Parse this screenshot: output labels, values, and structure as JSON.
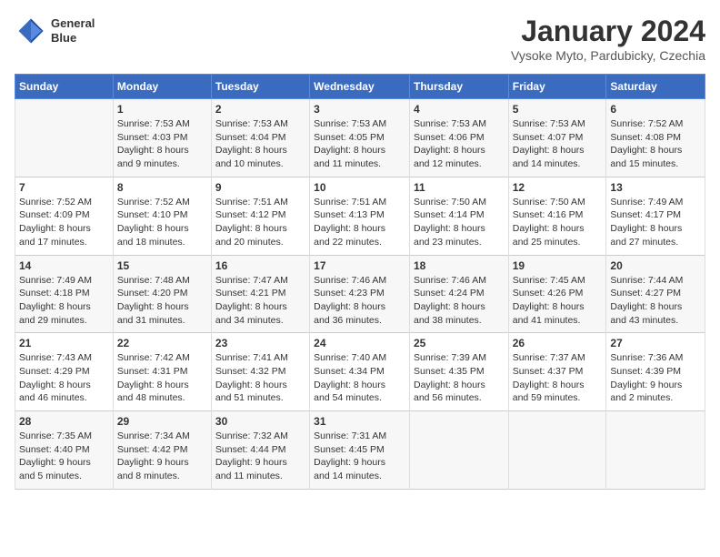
{
  "logo": {
    "line1": "General",
    "line2": "Blue"
  },
  "title": "January 2024",
  "subtitle": "Vysoke Myto, Pardubicky, Czechia",
  "days_header": [
    "Sunday",
    "Monday",
    "Tuesday",
    "Wednesday",
    "Thursday",
    "Friday",
    "Saturday"
  ],
  "weeks": [
    [
      {
        "day": "",
        "info": ""
      },
      {
        "day": "1",
        "info": "Sunrise: 7:53 AM\nSunset: 4:03 PM\nDaylight: 8 hours\nand 9 minutes."
      },
      {
        "day": "2",
        "info": "Sunrise: 7:53 AM\nSunset: 4:04 PM\nDaylight: 8 hours\nand 10 minutes."
      },
      {
        "day": "3",
        "info": "Sunrise: 7:53 AM\nSunset: 4:05 PM\nDaylight: 8 hours\nand 11 minutes."
      },
      {
        "day": "4",
        "info": "Sunrise: 7:53 AM\nSunset: 4:06 PM\nDaylight: 8 hours\nand 12 minutes."
      },
      {
        "day": "5",
        "info": "Sunrise: 7:53 AM\nSunset: 4:07 PM\nDaylight: 8 hours\nand 14 minutes."
      },
      {
        "day": "6",
        "info": "Sunrise: 7:52 AM\nSunset: 4:08 PM\nDaylight: 8 hours\nand 15 minutes."
      }
    ],
    [
      {
        "day": "7",
        "info": "Sunrise: 7:52 AM\nSunset: 4:09 PM\nDaylight: 8 hours\nand 17 minutes."
      },
      {
        "day": "8",
        "info": "Sunrise: 7:52 AM\nSunset: 4:10 PM\nDaylight: 8 hours\nand 18 minutes."
      },
      {
        "day": "9",
        "info": "Sunrise: 7:51 AM\nSunset: 4:12 PM\nDaylight: 8 hours\nand 20 minutes."
      },
      {
        "day": "10",
        "info": "Sunrise: 7:51 AM\nSunset: 4:13 PM\nDaylight: 8 hours\nand 22 minutes."
      },
      {
        "day": "11",
        "info": "Sunrise: 7:50 AM\nSunset: 4:14 PM\nDaylight: 8 hours\nand 23 minutes."
      },
      {
        "day": "12",
        "info": "Sunrise: 7:50 AM\nSunset: 4:16 PM\nDaylight: 8 hours\nand 25 minutes."
      },
      {
        "day": "13",
        "info": "Sunrise: 7:49 AM\nSunset: 4:17 PM\nDaylight: 8 hours\nand 27 minutes."
      }
    ],
    [
      {
        "day": "14",
        "info": "Sunrise: 7:49 AM\nSunset: 4:18 PM\nDaylight: 8 hours\nand 29 minutes."
      },
      {
        "day": "15",
        "info": "Sunrise: 7:48 AM\nSunset: 4:20 PM\nDaylight: 8 hours\nand 31 minutes."
      },
      {
        "day": "16",
        "info": "Sunrise: 7:47 AM\nSunset: 4:21 PM\nDaylight: 8 hours\nand 34 minutes."
      },
      {
        "day": "17",
        "info": "Sunrise: 7:46 AM\nSunset: 4:23 PM\nDaylight: 8 hours\nand 36 minutes."
      },
      {
        "day": "18",
        "info": "Sunrise: 7:46 AM\nSunset: 4:24 PM\nDaylight: 8 hours\nand 38 minutes."
      },
      {
        "day": "19",
        "info": "Sunrise: 7:45 AM\nSunset: 4:26 PM\nDaylight: 8 hours\nand 41 minutes."
      },
      {
        "day": "20",
        "info": "Sunrise: 7:44 AM\nSunset: 4:27 PM\nDaylight: 8 hours\nand 43 minutes."
      }
    ],
    [
      {
        "day": "21",
        "info": "Sunrise: 7:43 AM\nSunset: 4:29 PM\nDaylight: 8 hours\nand 46 minutes."
      },
      {
        "day": "22",
        "info": "Sunrise: 7:42 AM\nSunset: 4:31 PM\nDaylight: 8 hours\nand 48 minutes."
      },
      {
        "day": "23",
        "info": "Sunrise: 7:41 AM\nSunset: 4:32 PM\nDaylight: 8 hours\nand 51 minutes."
      },
      {
        "day": "24",
        "info": "Sunrise: 7:40 AM\nSunset: 4:34 PM\nDaylight: 8 hours\nand 54 minutes."
      },
      {
        "day": "25",
        "info": "Sunrise: 7:39 AM\nSunset: 4:35 PM\nDaylight: 8 hours\nand 56 minutes."
      },
      {
        "day": "26",
        "info": "Sunrise: 7:37 AM\nSunset: 4:37 PM\nDaylight: 8 hours\nand 59 minutes."
      },
      {
        "day": "27",
        "info": "Sunrise: 7:36 AM\nSunset: 4:39 PM\nDaylight: 9 hours\nand 2 minutes."
      }
    ],
    [
      {
        "day": "28",
        "info": "Sunrise: 7:35 AM\nSunset: 4:40 PM\nDaylight: 9 hours\nand 5 minutes."
      },
      {
        "day": "29",
        "info": "Sunrise: 7:34 AM\nSunset: 4:42 PM\nDaylight: 9 hours\nand 8 minutes."
      },
      {
        "day": "30",
        "info": "Sunrise: 7:32 AM\nSunset: 4:44 PM\nDaylight: 9 hours\nand 11 minutes."
      },
      {
        "day": "31",
        "info": "Sunrise: 7:31 AM\nSunset: 4:45 PM\nDaylight: 9 hours\nand 14 minutes."
      },
      {
        "day": "",
        "info": ""
      },
      {
        "day": "",
        "info": ""
      },
      {
        "day": "",
        "info": ""
      }
    ]
  ]
}
